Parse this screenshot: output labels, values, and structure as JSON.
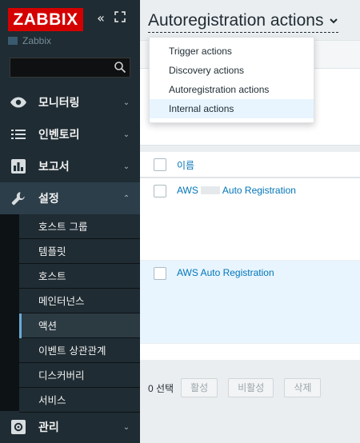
{
  "sidebar": {
    "logo": "ZABBIX",
    "node_name": "Zabbix",
    "search": {
      "value": "",
      "placeholder": ""
    },
    "menu": [
      {
        "label": "모니터링",
        "icon": "eye-icon",
        "expanded": false
      },
      {
        "label": "인벤토리",
        "icon": "list-icon",
        "expanded": false
      },
      {
        "label": "보고서",
        "icon": "bar-chart-icon",
        "expanded": false
      },
      {
        "label": "설정",
        "icon": "wrench-icon",
        "expanded": true
      },
      {
        "label": "관리",
        "icon": "gear-icon",
        "expanded": false
      }
    ],
    "submenu": [
      {
        "label": "호스트 그룹"
      },
      {
        "label": "템플릿"
      },
      {
        "label": "호스트"
      },
      {
        "label": "메인터넌스"
      },
      {
        "label": "액션",
        "selected": true
      },
      {
        "label": "이벤트 상관관계"
      },
      {
        "label": "디스커버리"
      },
      {
        "label": "서비스"
      }
    ]
  },
  "main": {
    "title": "Autoregistration actions",
    "dropdown": {
      "items": [
        {
          "label": "Trigger actions"
        },
        {
          "label": "Discovery actions"
        },
        {
          "label": "Autoregistration actions"
        },
        {
          "label": "Internal actions",
          "hovered": true
        }
      ]
    },
    "table": {
      "column_name": "이름",
      "rows": [
        {
          "name_prefix": "AWS",
          "name_suffix": "Auto Registration",
          "redacted": true
        },
        {
          "name": "AWS Auto Registration"
        }
      ]
    },
    "footer": {
      "selected_count": "0 선택",
      "buttons": [
        "활성",
        "비활성",
        "삭제"
      ]
    }
  },
  "colors": {
    "sidebar_bg": "#1f2c33",
    "logo_red": "#d40000",
    "link_blue": "#0275b8",
    "row_highlight": "#e8f5ff"
  }
}
